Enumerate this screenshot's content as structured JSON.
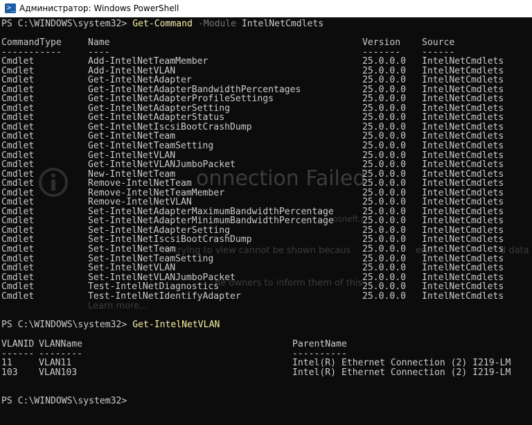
{
  "window": {
    "title": "Администратор: Windows PowerShell"
  },
  "background": {
    "error_title": "onnection Failed",
    "line1": "osneft.r",
    "line2": "re trying to view cannot be shown becaus",
    "line2b": "enti",
    "line2c": "d data",
    "line3": "he owners to inform them of this",
    "learn_more": "Learn more..."
  },
  "session1": {
    "prompt": "PS C:\\WINDOWS\\system32> ",
    "cmd": "Get-Command",
    "param": "-Module",
    "arg": "IntelNetCmdlets",
    "headers": [
      "CommandType",
      "Name",
      "Version",
      "Source"
    ],
    "dashes": [
      "-----------",
      "----",
      "-------",
      "------"
    ],
    "rows": [
      [
        "Cmdlet",
        "Add-IntelNetTeamMember",
        "25.0.0.0",
        "IntelNetCmdlets"
      ],
      [
        "Cmdlet",
        "Add-IntelNetVLAN",
        "25.0.0.0",
        "IntelNetCmdlets"
      ],
      [
        "Cmdlet",
        "Get-IntelNetAdapter",
        "25.0.0.0",
        "IntelNetCmdlets"
      ],
      [
        "Cmdlet",
        "Get-IntelNetAdapterBandwidthPercentages",
        "25.0.0.0",
        "IntelNetCmdlets"
      ],
      [
        "Cmdlet",
        "Get-IntelNetAdapterProfileSettings",
        "25.0.0.0",
        "IntelNetCmdlets"
      ],
      [
        "Cmdlet",
        "Get-IntelNetAdapterSetting",
        "25.0.0.0",
        "IntelNetCmdlets"
      ],
      [
        "Cmdlet",
        "Get-IntelNetAdapterStatus",
        "25.0.0.0",
        "IntelNetCmdlets"
      ],
      [
        "Cmdlet",
        "Get-IntelNetIscsiBootCrashDump",
        "25.0.0.0",
        "IntelNetCmdlets"
      ],
      [
        "Cmdlet",
        "Get-IntelNetTeam",
        "25.0.0.0",
        "IntelNetCmdlets"
      ],
      [
        "Cmdlet",
        "Get-IntelNetTeamSetting",
        "25.0.0.0",
        "IntelNetCmdlets"
      ],
      [
        "Cmdlet",
        "Get-IntelNetVLAN",
        "25.0.0.0",
        "IntelNetCmdlets"
      ],
      [
        "Cmdlet",
        "Get-IntelNetVLANJumboPacket",
        "25.0.0.0",
        "IntelNetCmdlets"
      ],
      [
        "Cmdlet",
        "New-IntelNetTeam",
        "25.0.0.0",
        "IntelNetCmdlets"
      ],
      [
        "Cmdlet",
        "Remove-IntelNetTeam",
        "25.0.0.0",
        "IntelNetCmdlets"
      ],
      [
        "Cmdlet",
        "Remove-IntelNetTeamMember",
        "25.0.0.0",
        "IntelNetCmdlets"
      ],
      [
        "Cmdlet",
        "Remove-IntelNetVLAN",
        "25.0.0.0",
        "IntelNetCmdlets"
      ],
      [
        "Cmdlet",
        "Set-IntelNetAdapterMaximumBandwidthPercentage",
        "25.0.0.0",
        "IntelNetCmdlets"
      ],
      [
        "Cmdlet",
        "Set-IntelNetAdapterMinimumBandwidthPercentage",
        "25.0.0.0",
        "IntelNetCmdlets"
      ],
      [
        "Cmdlet",
        "Set-IntelNetAdapterSetting",
        "25.0.0.0",
        "IntelNetCmdlets"
      ],
      [
        "Cmdlet",
        "Set-IntelNetIscsiBootCrashDump",
        "25.0.0.0",
        "IntelNetCmdlets"
      ],
      [
        "Cmdlet",
        "Set-IntelNetTeam",
        "25.0.0.0",
        "IntelNetCmdlets"
      ],
      [
        "Cmdlet",
        "Set-IntelNetTeamSetting",
        "25.0.0.0",
        "IntelNetCmdlets"
      ],
      [
        "Cmdlet",
        "Set-IntelNetVLAN",
        "25.0.0.0",
        "IntelNetCmdlets"
      ],
      [
        "Cmdlet",
        "Set-IntelNetVLANJumboPacket",
        "25.0.0.0",
        "IntelNetCmdlets"
      ],
      [
        "Cmdlet",
        "Test-IntelNetDiagnostics",
        "25.0.0.0",
        "IntelNetCmdlets"
      ],
      [
        "Cmdlet",
        "Test-IntelNetIdentifyAdapter",
        "25.0.0.0",
        "IntelNetCmdlets"
      ]
    ]
  },
  "session2": {
    "prompt": "PS C:\\WINDOWS\\system32> ",
    "cmd": "Get-IntelNetVLAN",
    "headers": [
      "VLANID",
      "VLANName",
      "ParentName"
    ],
    "dashes": [
      "------",
      "--------",
      "----------"
    ],
    "rows": [
      [
        "11",
        "VLAN11",
        "Intel(R) Ethernet Connection (2) I219-LM"
      ],
      [
        "103",
        "VLAN103",
        "Intel(R) Ethernet Connection (2) I219-LM"
      ]
    ]
  },
  "session3": {
    "prompt": "PS C:\\WINDOWS\\system32>"
  },
  "colors": {
    "console_bg": "#0c0c0c",
    "text": "#cccccc",
    "command": "#f9f1a5",
    "parameter": "#767676"
  },
  "icons": {
    "window": "powershell-icon",
    "ghost": "info-icon"
  }
}
